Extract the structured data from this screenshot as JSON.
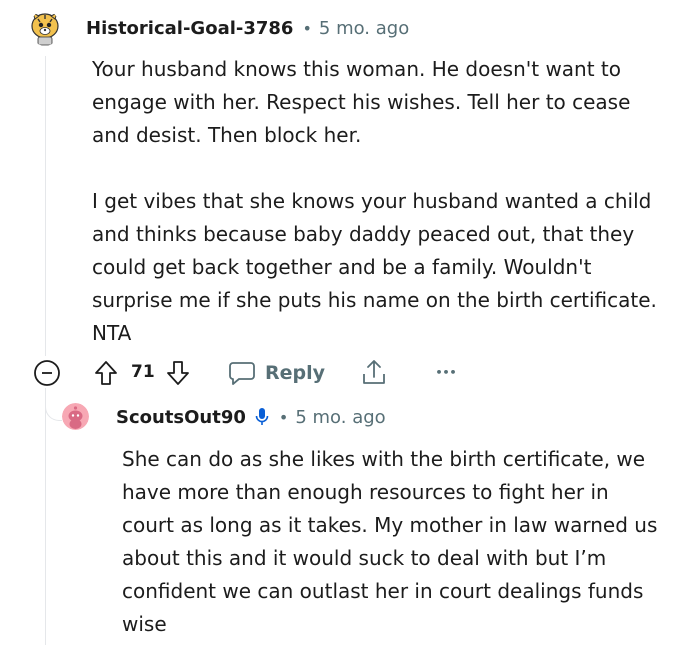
{
  "comment": {
    "username": "Historical-Goal-3786",
    "separator": "•",
    "age": "5 mo. ago",
    "paragraphs": [
      "Your husband knows this woman. He doesn't want to engage with her. Respect his wishes. Tell her to cease and desist. Then block her.",
      "I get vibes that she knows your husband wanted a child and thinks because baby daddy peaced out, that they could get back together and be a family. Wouldn't surprise me if she puts his name on the birth certificate. NTA"
    ],
    "avatar_icon": "cartoon-tiger-avatar"
  },
  "actions": {
    "collapse_icon": "minus-circle-icon",
    "upvote_icon": "arrow-up-icon",
    "vote_count": "71",
    "downvote_icon": "arrow-down-icon",
    "reply_icon": "speech-bubble-icon",
    "reply_label": "Reply",
    "share_icon": "share-icon",
    "more_icon": "more-dots-icon",
    "more_label": "•••"
  },
  "reply": {
    "username": "ScoutsOut90",
    "separator": "•",
    "age": "5 mo. ago",
    "badge_icon": "microphone-icon",
    "avatar_icon": "pink-snoo-avatar",
    "paragraphs": [
      "She can do as she likes with the birth certificate, we have more than enough resources to fight her in court as long as it takes. My mother in law warned us about this and it would suck to deal with but I’m confident we can outlast her in court dealings funds wise"
    ]
  },
  "colors": {
    "text": "#1c1c1c",
    "meta": "#576f76",
    "thread_line": "#e5e7ea",
    "badge_blue": "#0a5fd6"
  }
}
